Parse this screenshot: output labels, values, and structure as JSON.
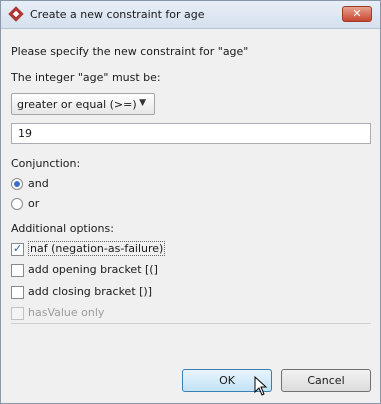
{
  "window": {
    "title": "Create a new constraint for age"
  },
  "prompt": "Please specify the new constraint for \"age\"",
  "integer_label": "The integer \"age\" must be:",
  "operator_select": {
    "selected": "greater or equal (>=)"
  },
  "value_input": {
    "value": "19"
  },
  "conjunction": {
    "label": "Conjunction:",
    "options": [
      {
        "label": "and",
        "selected": true
      },
      {
        "label": "or",
        "selected": false
      }
    ]
  },
  "additional": {
    "label": "Additional options:",
    "options": [
      {
        "label": "naf (negation-as-failure)",
        "checked": true,
        "enabled": true
      },
      {
        "label": "add opening bracket [(]",
        "checked": false,
        "enabled": true
      },
      {
        "label": "add closing bracket [)]",
        "checked": false,
        "enabled": true
      },
      {
        "label": "hasValue only",
        "checked": false,
        "enabled": false
      }
    ]
  },
  "buttons": {
    "ok": "OK",
    "cancel": "Cancel"
  },
  "icons": {
    "app": "app-diamond-icon",
    "close": "close-icon",
    "dropdown": "chevron-down-icon",
    "cursor": "mouse-pointer-icon"
  },
  "colors": {
    "close_button": "#c7462f",
    "radio_selected": "#3a6fcf",
    "default_button_border": "#3c7fb1"
  }
}
